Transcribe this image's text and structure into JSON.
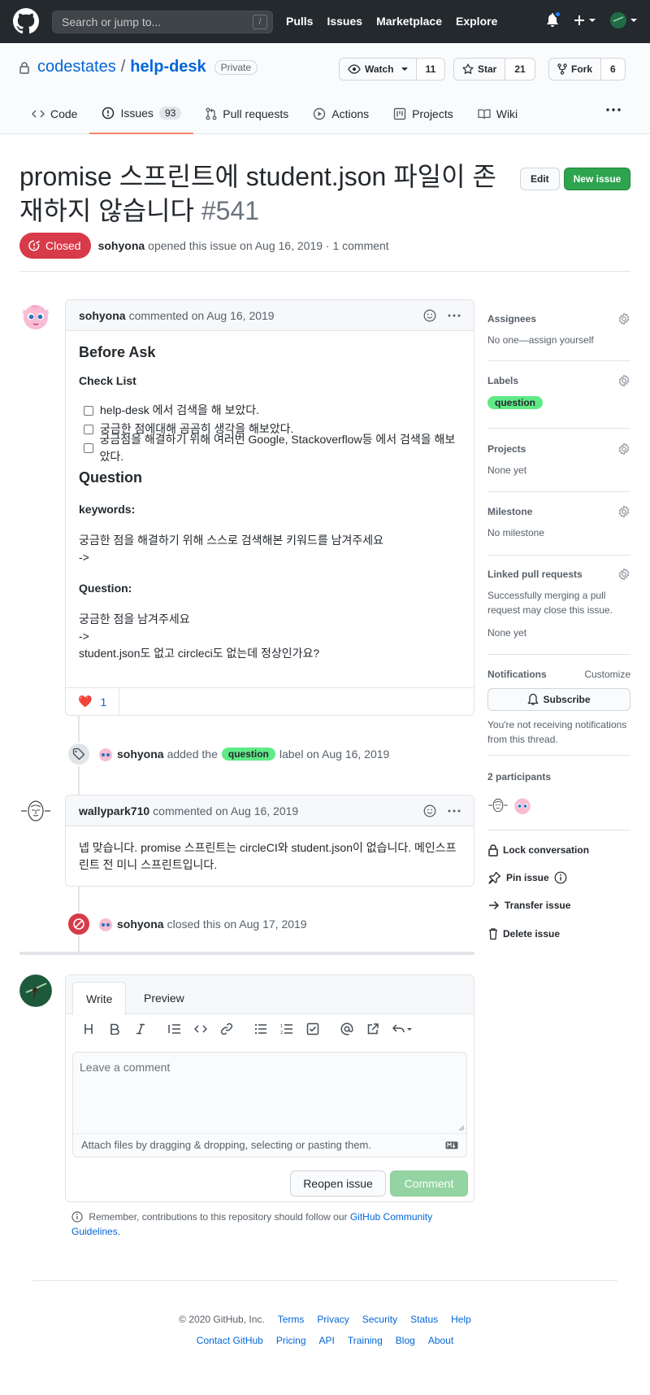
{
  "header": {
    "search_placeholder": "Search or jump to...",
    "search_shortcut": "/",
    "nav": [
      "Pulls",
      "Issues",
      "Marketplace",
      "Explore"
    ]
  },
  "repo": {
    "owner": "codestates",
    "separator": "/",
    "name": "help-desk",
    "visibility": "Private",
    "watch_label": "Watch",
    "watch_count": "11",
    "star_label": "Star",
    "star_count": "21",
    "fork_label": "Fork",
    "fork_count": "6",
    "tabs": [
      {
        "label": "Code"
      },
      {
        "label": "Issues",
        "count": "93"
      },
      {
        "label": "Pull requests"
      },
      {
        "label": "Actions"
      },
      {
        "label": "Projects"
      },
      {
        "label": "Wiki"
      }
    ]
  },
  "issue": {
    "title": "promise 스프린트에 student.json 파일이 존재하지 않습니다",
    "number": "#541",
    "edit_label": "Edit",
    "new_issue_label": "New issue",
    "state": "Closed",
    "author": "sohyona",
    "opened_text": "opened this issue on Aug 16, 2019 · 1 comment"
  },
  "first_comment": {
    "author": "sohyona",
    "meta": "commented on Aug 16, 2019",
    "h_before": "Before Ask",
    "h_checklist": "Check List",
    "checks": [
      "help-desk 에서 검색을 해 보았다.",
      "궁금한 점에대해 곰곰히 생각을 해보았다.",
      "궁금점을 해결하기 위해 여러번 Google, Stackoverflow등 에서 검색을 해보았다."
    ],
    "h_question": "Question",
    "kw_label": "keywords:",
    "kw_line1": "궁금한 점을 해결하기 위해 스스로 검색해본 키워드를 남겨주세요",
    "kw_line2": "->",
    "q_label": "Question:",
    "q_line1": "궁금한 점을 남겨주세요",
    "q_line2": "->",
    "q_line3": "student.json도 없고 circleci도 없는데 정상인가요?",
    "reaction_emoji": "❤️",
    "reaction_count": "1"
  },
  "label_event": {
    "actor": "sohyona",
    "text_before": "added the",
    "label": "question",
    "text_after": "label on Aug 16, 2019"
  },
  "second_comment": {
    "author": "wallypark710",
    "meta": "commented on Aug 16, 2019",
    "body": "넵 맞습니다. promise 스프린트는 circleCI와 student.json이 없습니다. 메인스프린트 전 미니 스프린트입니다."
  },
  "close_event": {
    "actor": "sohyona",
    "text": "closed this on Aug 17, 2019"
  },
  "composer": {
    "tab_write": "Write",
    "tab_preview": "Preview",
    "placeholder": "Leave a comment",
    "attach_text": "Attach files by dragging & dropping, selecting or pasting them.",
    "reopen_label": "Reopen issue",
    "comment_label": "Comment",
    "remember_text": "Remember, contributions to this repository should follow our",
    "guidelines_link": "GitHub Community Guidelines."
  },
  "sidebar": {
    "assignees_h": "Assignees",
    "assignees_t": "No one—assign yourself",
    "labels_h": "Labels",
    "labels_value": "question",
    "projects_h": "Projects",
    "projects_t": "None yet",
    "milestone_h": "Milestone",
    "milestone_t": "No milestone",
    "linked_h": "Linked pull requests",
    "linked_t": "Successfully merging a pull request may close this issue.",
    "linked_none": "None yet",
    "notif_h": "Notifications",
    "notif_customize": "Customize",
    "subscribe_label": "Subscribe",
    "notif_t": "You're not receiving notifications from this thread.",
    "participants_h": "2 participants",
    "lock_label": "Lock conversation",
    "pin_label": "Pin issue",
    "transfer_label": "Transfer issue",
    "delete_label": "Delete issue"
  },
  "footer": {
    "copyright": "© 2020 GitHub, Inc.",
    "row1": [
      "Terms",
      "Privacy",
      "Security",
      "Status",
      "Help"
    ],
    "row2": [
      "Contact GitHub",
      "Pricing",
      "API",
      "Training",
      "Blog",
      "About"
    ]
  },
  "colors": {
    "closed": "#d73a49",
    "label_question": "#5fea86",
    "primary": "#2ea44f",
    "link": "#0366d6"
  }
}
